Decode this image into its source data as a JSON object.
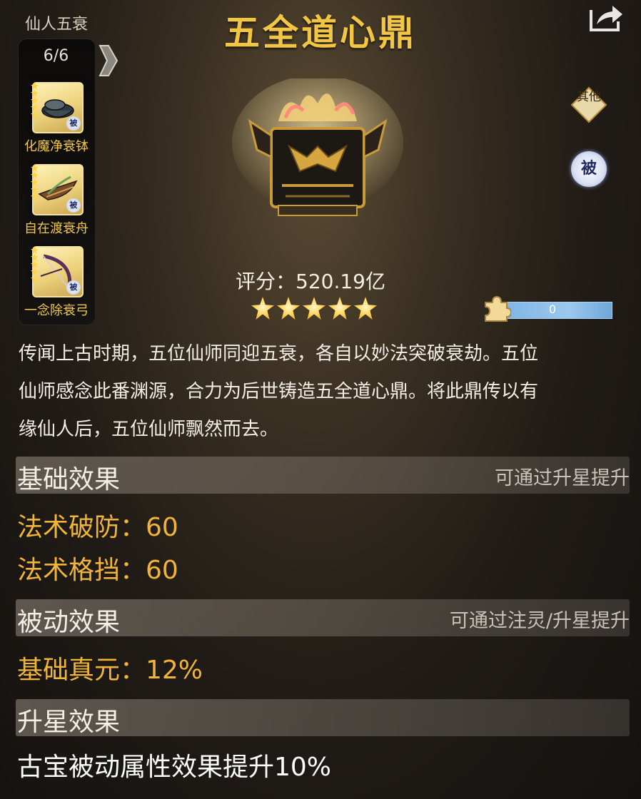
{
  "set": {
    "caption": "仙人五衰",
    "count": "6/6",
    "items": [
      {
        "name": "化魔净衰钵",
        "badge": "被"
      },
      {
        "name": "自在渡衰舟",
        "badge": "被"
      },
      {
        "name": "一念除衰弓",
        "badge": "被"
      }
    ]
  },
  "item": {
    "title": "五全道心鼎",
    "score": "评分：520.19亿",
    "stars": 5,
    "fragment_value": "0",
    "tag_other": "其他",
    "tag_passive": "被",
    "description_lines": [
      "传闻上古时期，五位仙师同迎五衰，各自以妙法突破衰劫。五位",
      "仙师感念此番渊源，合力为后世铸造五全道心鼎。将此鼎传以有",
      "缘仙人后，五位仙师飘然而去。"
    ]
  },
  "sections": {
    "base": {
      "title": "基础效果",
      "hint": "可通过升星提升",
      "stats": [
        "法术破防：60",
        "法术格挡：60"
      ]
    },
    "passive": {
      "title": "被动效果",
      "hint": "可通过注灵/升星提升",
      "stats": [
        "基础真元：12%"
      ]
    },
    "star": {
      "title": "升星效果",
      "text": "古宝被动属性效果提升10%"
    }
  },
  "colors": {
    "title_gold": "#f2c643",
    "stat_orange": "#f0b43a",
    "set_name_gold": "#f1c84a",
    "fragment_bar": "#8fc0ea"
  },
  "icons": [
    "share-icon",
    "arrow-right-icon",
    "puzzle-fragment-icon",
    "star-icon"
  ]
}
